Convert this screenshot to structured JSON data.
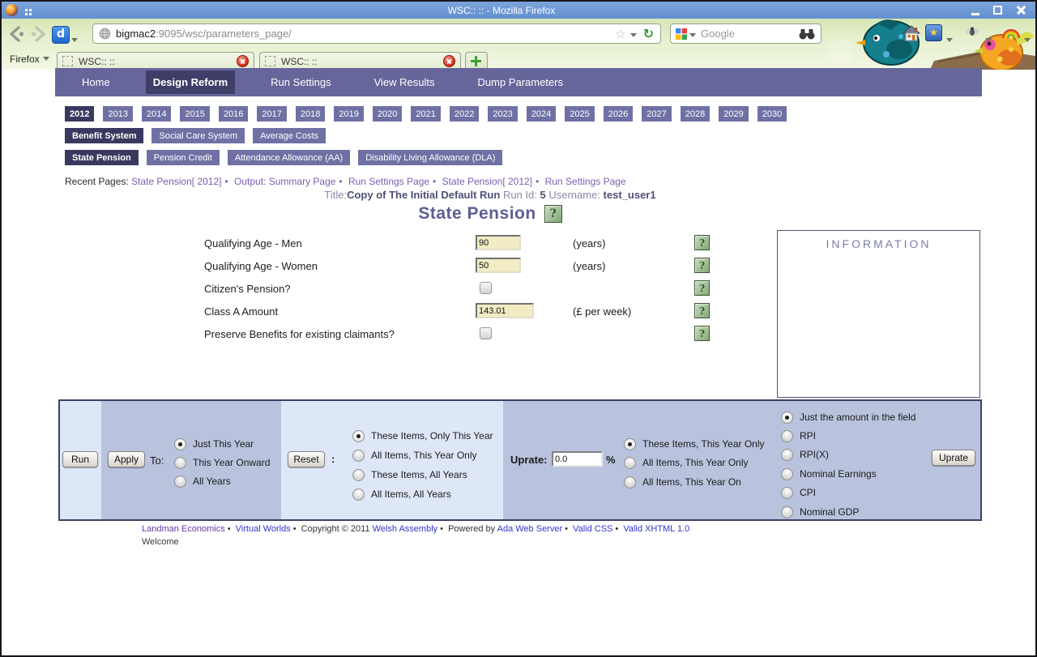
{
  "window": {
    "title": "WSC::  :: - Mozilla Firefox"
  },
  "toolbar": {
    "url_host": "bigmac2",
    "url_rest": ":9095/wsc/parameters_page/",
    "search_placeholder": "Google"
  },
  "tabbar": {
    "menu_label": "Firefox",
    "tabs": [
      {
        "label": "WSC::  ::"
      },
      {
        "label": "WSC::  ::"
      }
    ]
  },
  "icons": {
    "caret": "▾",
    "star": "☆",
    "reload": "↻",
    "help": "?",
    "d_logo": "d",
    "book_star": "★",
    "bullet": "•"
  },
  "nav": {
    "items": [
      "Home",
      "Design Reform",
      "Run Settings",
      "View Results",
      "Dump Parameters"
    ],
    "active": "Design Reform"
  },
  "years": {
    "items": [
      "2012",
      "2013",
      "2014",
      "2015",
      "2016",
      "2017",
      "2018",
      "2019",
      "2020",
      "2021",
      "2022",
      "2023",
      "2024",
      "2025",
      "2026",
      "2027",
      "2028",
      "2029",
      "2030"
    ],
    "active": "2012"
  },
  "systems": {
    "items": [
      "Benefit System",
      "Social Care System",
      "Average Costs"
    ],
    "active": "Benefit System"
  },
  "programs": {
    "items": [
      "State Pension",
      "Pension Credit",
      "Attendance Allowance (AA)",
      "Disability Living Allowance (DLA)"
    ],
    "active": "State Pension"
  },
  "breadcrumb": {
    "label": "Recent Pages:",
    "bullet": "•",
    "links": [
      "State Pension[ 2012]",
      "Output: Summary Page",
      "Run Settings Page",
      "State Pension[ 2012]",
      "Run Settings Page"
    ]
  },
  "run_info": {
    "title_label": "Title:",
    "title": "Copy of The Initial Default Run",
    "run_id_label": "Run Id:",
    "run_id": "5",
    "username_label": "Username:",
    "username": "test_user1"
  },
  "page": {
    "heading": "State Pension"
  },
  "form": {
    "rows": [
      {
        "label": "Qualifying Age - Men",
        "control": "input",
        "value": "90",
        "unit": "(years)"
      },
      {
        "label": "Qualifying Age - Women",
        "control": "input",
        "value": "50",
        "unit": "(years)"
      },
      {
        "label": "Citizen's Pension?",
        "control": "checkbox",
        "checked": false
      },
      {
        "label": "Class A Amount",
        "control": "input",
        "value": "143.01",
        "unit": "(£ per week)"
      },
      {
        "label": "Preserve Benefits for existing claimants?",
        "control": "checkbox",
        "checked": false
      }
    ]
  },
  "info_box": {
    "title": "INFORMATION"
  },
  "controls": {
    "run_label": "Run",
    "apply_label": "Apply",
    "to_label": "To:",
    "reset_label": "Reset",
    "reset_sep": ":",
    "uprate_label": "Uprate:",
    "uprate_value": "0.0",
    "percent_label": "%",
    "uprate_button_label": "Uprate",
    "apply_scope": {
      "options": [
        "Just This Year",
        "This Year Onward",
        "All Years"
      ],
      "selected": "Just This Year"
    },
    "reset_scope": {
      "options": [
        "These Items, Only This Year",
        "All Items, This Year Only",
        "These Items, All Years",
        "All Items, All Years"
      ],
      "selected": "These Items, Only This Year"
    },
    "uprate_scope": {
      "options": [
        "These Items, This Year Only",
        "All Items, This Year Only",
        "All Items, This Year On"
      ],
      "selected": "These Items, This Year Only"
    },
    "uprate_index": {
      "options": [
        "Just the amount in the field",
        "RPI",
        "RPI(X)",
        "Nominal Earnings",
        "CPI",
        "Nominal GDP"
      ],
      "selected": "Just the amount in the field"
    }
  },
  "footer": {
    "parts": [
      "Landman Economics",
      "Virtual Worlds",
      "Copyright © 2011",
      "Welsh Assembly",
      "Powered by",
      "Ada Web Server",
      "Valid CSS",
      "Valid XHTML 1.0"
    ],
    "welcome": "Welcome"
  },
  "colors": {
    "titlebar_blue": "#6490CF",
    "nav_purple": "#66669B",
    "nav_selected": "#3E3E69",
    "input_cream": "#F2ECC4",
    "help_green": "#83A678",
    "bar_light": "#DEE7F7",
    "bar_dark": "#B9C3DD",
    "link_blue": "#3434CC",
    "link_purple": "#6A35A8"
  }
}
